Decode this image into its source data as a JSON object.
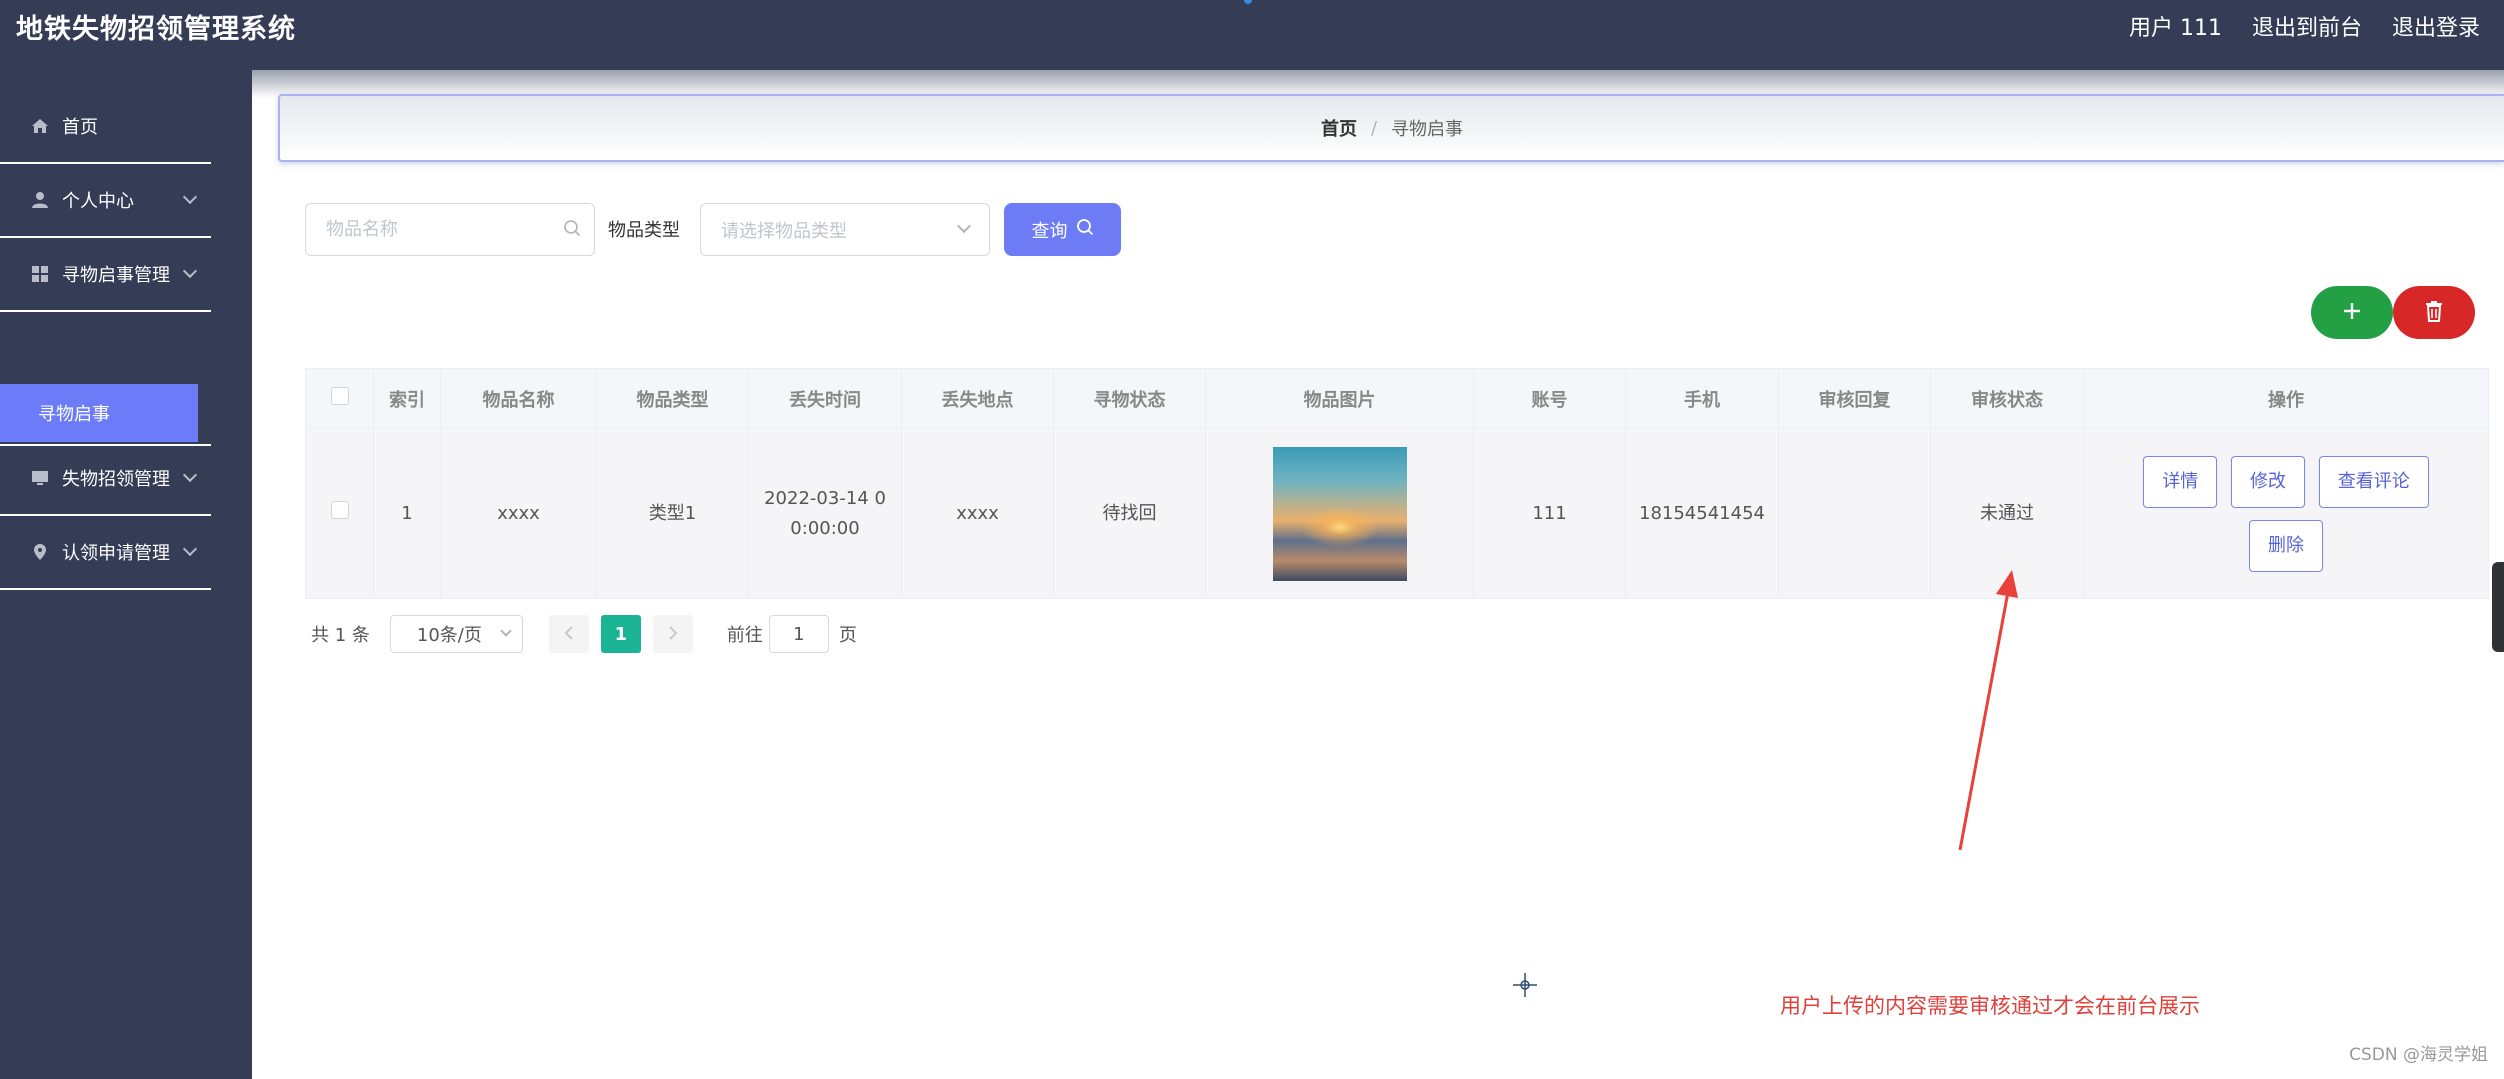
{
  "header": {
    "title": "地铁失物招领管理系统",
    "user": "用户 111",
    "to_front": "退出到前台",
    "logout": "退出登录"
  },
  "sidebar": {
    "items": [
      {
        "label": "首页",
        "icon": "home-icon"
      },
      {
        "label": "个人中心",
        "icon": "user-icon"
      },
      {
        "label": "寻物启事管理",
        "icon": "grid-icon"
      },
      {
        "label": "失物招领管理",
        "icon": "monitor-icon"
      },
      {
        "label": "认领申请管理",
        "icon": "location-icon"
      }
    ],
    "active_sub": "寻物启事"
  },
  "breadcrumb": {
    "home": "首页",
    "separator": "/",
    "current": "寻物启事"
  },
  "filters": {
    "name_placeholder": "物品名称",
    "type_label": "物品类型",
    "type_placeholder": "请选择物品类型",
    "query_label": "查询"
  },
  "table": {
    "headers": [
      "索引",
      "物品名称",
      "物品类型",
      "丢失时间",
      "丢失地点",
      "寻物状态",
      "物品图片",
      "账号",
      "手机",
      "审核回复",
      "审核状态",
      "操作"
    ],
    "rows": [
      {
        "index": "1",
        "name": "xxxx",
        "type": "类型1",
        "lost_time_line1": "2022-03-14 0",
        "lost_time_line2": "0:00:00",
        "place": "xxxx",
        "status": "待找回",
        "account": "111",
        "phone": "18154541454",
        "review_reply": "",
        "review_status": "未通过",
        "actions": {
          "detail": "详情",
          "edit": "修改",
          "comments": "查看评论",
          "delete": "删除"
        }
      }
    ]
  },
  "pagination": {
    "total": "共 1 条",
    "page_size": "10条/页",
    "current_page": "1",
    "goto_label": "前往",
    "goto_value": "1",
    "page_unit": "页"
  },
  "annotation": {
    "text": "用户上传的内容需要审核通过才会在前台展示",
    "color": "#e0403b"
  },
  "watermark": "CSDN @海灵学姐",
  "colors": {
    "sidebar_bg": "#343c56",
    "accent": "#6d7cf5",
    "add_button": "#23a044",
    "delete_button": "#d72727",
    "page_active": "#1ab394"
  }
}
